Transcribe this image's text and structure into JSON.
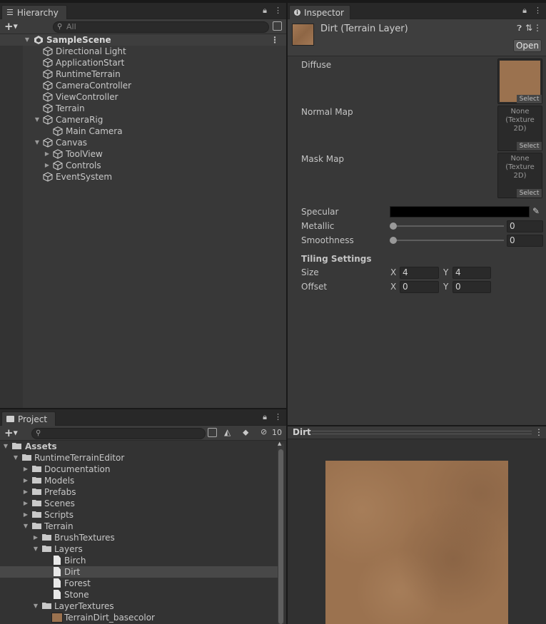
{
  "hierarchy": {
    "tab_label": "Hierarchy",
    "search_placeholder": "All",
    "scene": "SampleScene",
    "items": [
      {
        "label": "Directional Light"
      },
      {
        "label": "ApplicationStart"
      },
      {
        "label": "RuntimeTerrain"
      },
      {
        "label": "CameraController"
      },
      {
        "label": "ViewController"
      },
      {
        "label": "Terrain"
      },
      {
        "label": "CameraRig"
      },
      {
        "label": "Main Camera"
      },
      {
        "label": "Canvas"
      },
      {
        "label": "ToolView"
      },
      {
        "label": "Controls"
      },
      {
        "label": "EventSystem"
      }
    ]
  },
  "inspector": {
    "tab_label": "Inspector",
    "object_name": "Dirt (Terrain Layer)",
    "open_button": "Open",
    "diffuse_label": "Diffuse",
    "normal_map_label": "Normal Map",
    "mask_map_label": "Mask Map",
    "select_label": "Select",
    "none_texture": "None\n(Texture 2D)",
    "none_line1": "None",
    "none_line2": "(Texture 2D)",
    "specular_label": "Specular",
    "specular_color": "#000000",
    "metallic_label": "Metallic",
    "metallic_value": "0",
    "smoothness_label": "Smoothness",
    "smoothness_value": "0",
    "tiling_header": "Tiling Settings",
    "size_label": "Size",
    "offset_label": "Offset",
    "x_label": "X",
    "y_label": "Y",
    "size_x": "4",
    "size_y": "4",
    "offset_x": "0",
    "offset_y": "0"
  },
  "project": {
    "tab_label": "Project",
    "hidden_count": "10",
    "tree": [
      {
        "label": "Assets"
      },
      {
        "label": "RuntimeTerrainEditor"
      },
      {
        "label": "Documentation"
      },
      {
        "label": "Models"
      },
      {
        "label": "Prefabs"
      },
      {
        "label": "Scenes"
      },
      {
        "label": "Scripts"
      },
      {
        "label": "Terrain"
      },
      {
        "label": "BrushTextures"
      },
      {
        "label": "Layers"
      },
      {
        "label": "Birch"
      },
      {
        "label": "Dirt"
      },
      {
        "label": "Forest"
      },
      {
        "label": "Stone"
      },
      {
        "label": "LayerTextures"
      },
      {
        "label": "TerrainDirt_basecolor"
      }
    ]
  },
  "preview": {
    "title": "Dirt"
  },
  "colors": {
    "selection": "#2f4d6a",
    "dirt": "#9b724f"
  }
}
